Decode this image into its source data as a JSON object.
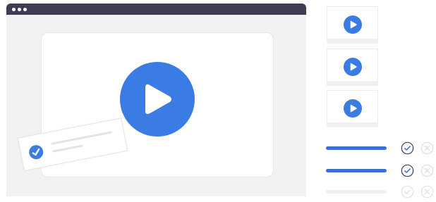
{
  "theme": {
    "accent": "#3b7be4",
    "window_bar": "#3f3d56",
    "window_body": "#f2f2f2"
  },
  "window": {
    "controls": [
      "dot",
      "dot",
      "dot"
    ]
  },
  "player": {
    "icon": "play-icon"
  },
  "note_card": {
    "icon": "check-circle-icon"
  },
  "thumbnails": [
    {
      "icon": "play-icon"
    },
    {
      "icon": "play-icon"
    },
    {
      "icon": "play-icon"
    }
  ],
  "checklist": [
    {
      "state": "complete",
      "icons": [
        "check-circle-outline-icon",
        "close-circle-outline-icon"
      ]
    },
    {
      "state": "complete",
      "icons": [
        "check-circle-outline-icon",
        "close-circle-outline-icon"
      ]
    },
    {
      "state": "pending",
      "icons": [
        "check-circle-outline-icon",
        "close-circle-outline-icon"
      ]
    }
  ]
}
